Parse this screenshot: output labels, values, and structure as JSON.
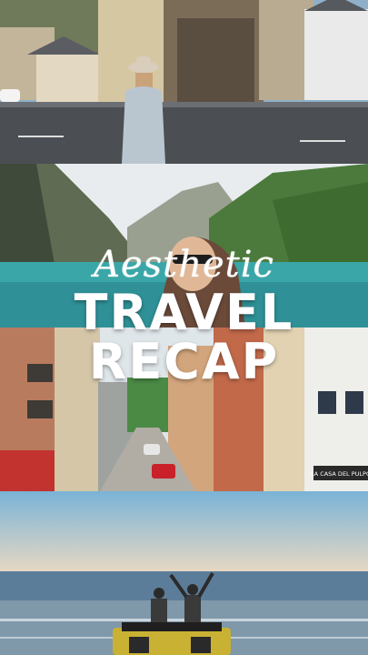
{
  "overlay": {
    "script_text": "Aesthetic",
    "line1": "TRAVEL",
    "line2": "RECAP"
  },
  "signs": {
    "restaurant": "LA CASA DEL PULPO"
  },
  "colors": {
    "water": "#3aa6a8",
    "sky_sea": "#7ab3d6",
    "jeep": "#c9b233"
  }
}
